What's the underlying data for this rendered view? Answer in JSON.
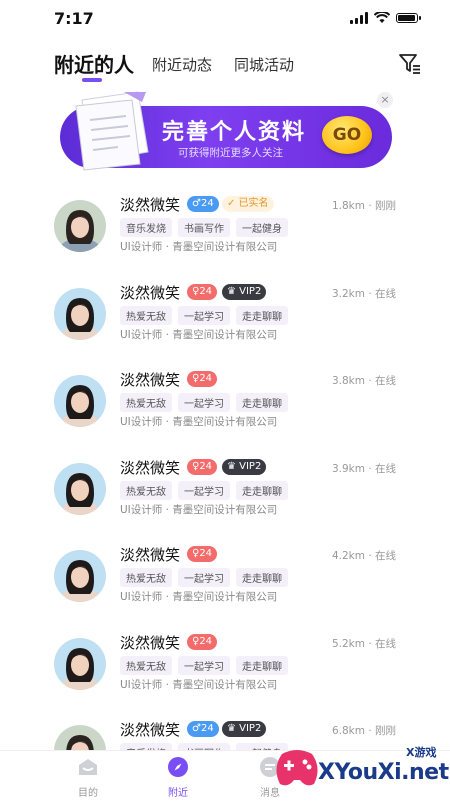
{
  "status": {
    "time": "7:17"
  },
  "tabs": [
    {
      "label": "附近的人"
    },
    {
      "label": "附近动态"
    },
    {
      "label": "同城活动"
    }
  ],
  "banner": {
    "title": "完善个人资料",
    "subtitle": "可获得附近更多人关注",
    "button_label": "GO",
    "close_label": "×"
  },
  "users": [
    {
      "name": "淡然微笑",
      "gender": "male",
      "age": "♂24",
      "badge": "已实名",
      "badge_type": "verified",
      "distance": "1.8km · 刚刚",
      "tags": [
        "音乐发烧",
        "书画写作",
        "一起健身"
      ],
      "job": "UI设计师 · 青墨空间设计有限公司"
    },
    {
      "name": "淡然微笑",
      "gender": "female",
      "age": "♀24",
      "badge": "VIP2",
      "badge_type": "vip",
      "distance": "3.2km · 在线",
      "tags": [
        "热爱无敌",
        "一起学习",
        "走走聊聊"
      ],
      "job": "UI设计师 · 青墨空间设计有限公司"
    },
    {
      "name": "淡然微笑",
      "gender": "female",
      "age": "♀24",
      "badge": "",
      "badge_type": "",
      "distance": "3.8km · 在线",
      "tags": [
        "热爱无敌",
        "一起学习",
        "走走聊聊"
      ],
      "job": "UI设计师 · 青墨空间设计有限公司"
    },
    {
      "name": "淡然微笑",
      "gender": "female",
      "age": "♀24",
      "badge": "VIP2",
      "badge_type": "vip",
      "distance": "3.9km · 在线",
      "tags": [
        "热爱无敌",
        "一起学习",
        "走走聊聊"
      ],
      "job": "UI设计师 · 青墨空间设计有限公司"
    },
    {
      "name": "淡然微笑",
      "gender": "female",
      "age": "♀24",
      "badge": "",
      "badge_type": "",
      "distance": "4.2km · 在线",
      "tags": [
        "热爱无敌",
        "一起学习",
        "走走聊聊"
      ],
      "job": "UI设计师 · 青墨空间设计有限公司"
    },
    {
      "name": "淡然微笑",
      "gender": "female",
      "age": "♀24",
      "badge": "",
      "badge_type": "",
      "distance": "5.2km · 在线",
      "tags": [
        "热爱无敌",
        "一起学习",
        "走走聊聊"
      ],
      "job": "UI设计师 · 青墨空间设计有限公司"
    },
    {
      "name": "淡然微笑",
      "gender": "male",
      "age": "♂24",
      "badge": "VIP2",
      "badge_type": "vip",
      "distance": "6.8km · 刚刚",
      "tags": [
        "音乐发烧",
        "书画写作",
        "一起健身"
      ],
      "job": ""
    }
  ],
  "bottom_nav": [
    {
      "label": "目的",
      "icon": "home-icon"
    },
    {
      "label": "附近",
      "icon": "compass-icon"
    },
    {
      "label": "消息",
      "icon": "message-icon"
    }
  ],
  "watermark": {
    "text": "XYouXi.net",
    "small": "X游戏"
  },
  "colors": {
    "accent": "#7a4ef5",
    "male": "#4a9af3",
    "female": "#f36b6b",
    "vip": "#3a3a42"
  }
}
